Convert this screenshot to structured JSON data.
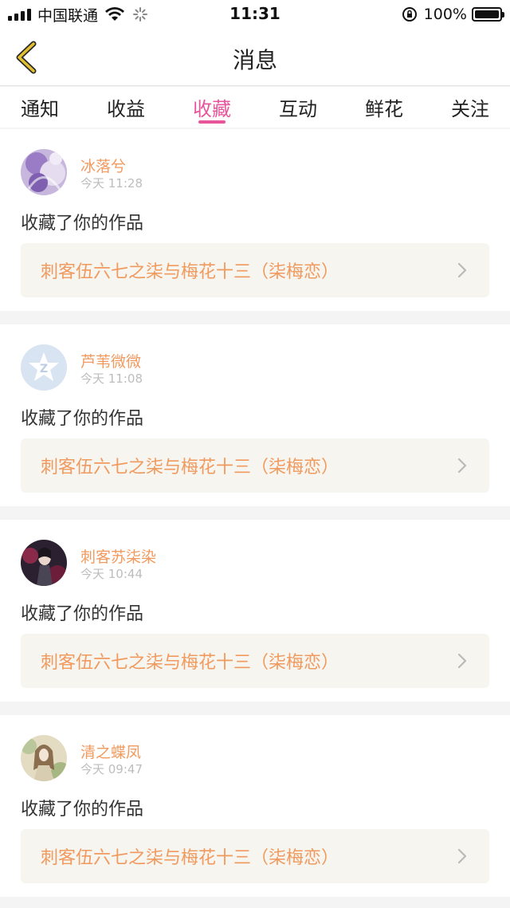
{
  "status_bar": {
    "carrier": "中国联通",
    "time": "11:31",
    "battery_percent": "100%"
  },
  "nav": {
    "title": "消息",
    "back_icon": "chevron-left-icon"
  },
  "tabs": [
    {
      "label": "通知",
      "active": false
    },
    {
      "label": "收益",
      "active": false
    },
    {
      "label": "收藏",
      "active": true
    },
    {
      "label": "互动",
      "active": false
    },
    {
      "label": "鲜花",
      "active": false
    },
    {
      "label": "关注",
      "active": false
    }
  ],
  "messages": [
    {
      "user": "冰落兮",
      "time": "今天 11:28",
      "action": "收藏了你的作品",
      "work": "刺客伍六七之柒与梅花十三（柒梅恋）"
    },
    {
      "user": "芦苇微微",
      "time": "今天 11:08",
      "action": "收藏了你的作品",
      "work": "刺客伍六七之柒与梅花十三（柒梅恋）"
    },
    {
      "user": "刺客苏柒染",
      "time": "今天 10:44",
      "action": "收藏了你的作品",
      "work": "刺客伍六七之柒与梅花十三（柒梅恋）"
    },
    {
      "user": "清之蝶凤",
      "time": "今天 09:47",
      "action": "收藏了你的作品",
      "work": "刺客伍六七之柒与梅花十三（柒梅恋）"
    }
  ],
  "colors": {
    "accent_pink": "#e8559a",
    "username_orange": "#f09a5f",
    "back_arrow_yellow": "#e2bf2e"
  }
}
